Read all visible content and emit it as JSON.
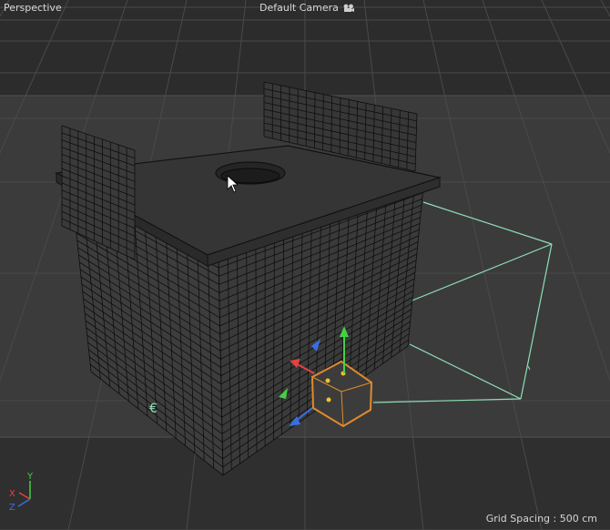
{
  "viewport": {
    "view_name": "Perspective",
    "camera_name": "Default Camera",
    "camera_icon": "camera-icon",
    "grid_spacing": "Grid Spacing : 500 cm"
  },
  "axis_gizmo": {
    "x": "X",
    "y": "Y",
    "z": "Z"
  },
  "colors": {
    "background_top": "#2c2c2c",
    "background_mid": "#3a3a3a",
    "background_bottom": "#2e2e2e",
    "grid_line": "#4a4a4a",
    "mesh_line": "#0e0e0e",
    "camera_frustum": "#8ee0b8",
    "selection": "#e08a2e",
    "axis_x": "#e04444",
    "axis_y": "#44d044",
    "axis_z": "#3a6ee0"
  }
}
